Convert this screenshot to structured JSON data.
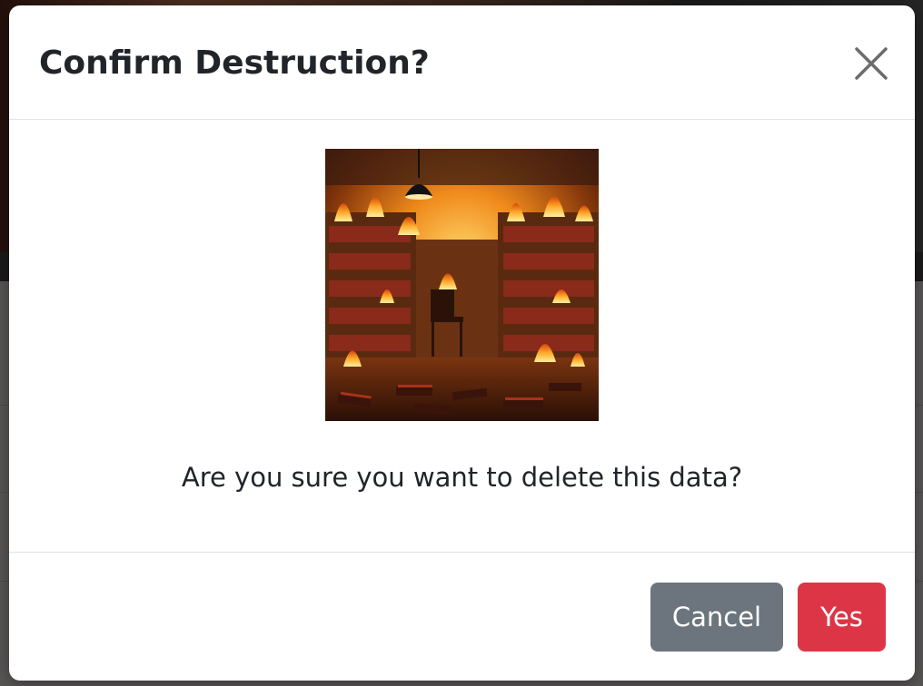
{
  "modal": {
    "title": "Confirm Destruction?",
    "image": {
      "icon": "burning-library-illustration"
    },
    "message": "Are you sure you want to delete this data?",
    "buttons": {
      "cancel_label": "Cancel",
      "confirm_label": "Yes"
    },
    "close_icon": "close-icon"
  },
  "colors": {
    "cancel": "#6c757d",
    "confirm": "#dc3545",
    "text": "#212529",
    "divider": "#dee2e6"
  }
}
